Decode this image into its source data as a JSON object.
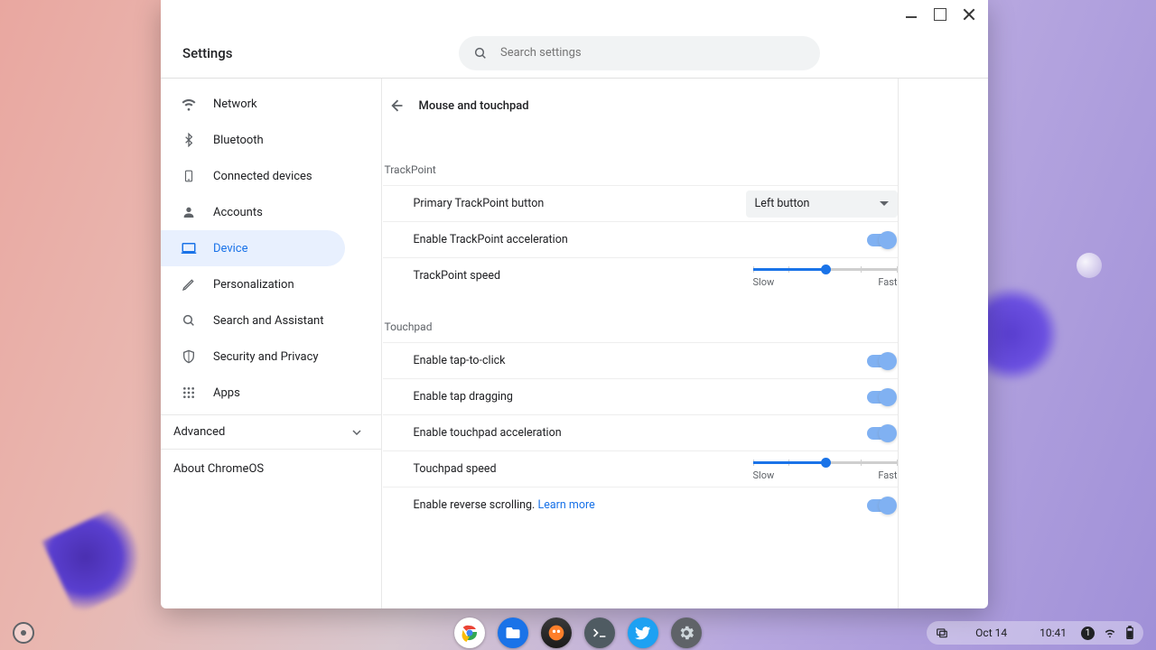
{
  "app": {
    "title": "Settings"
  },
  "search": {
    "placeholder": "Search settings"
  },
  "sidebar": {
    "items": [
      {
        "id": "network",
        "label": "Network"
      },
      {
        "id": "bluetooth",
        "label": "Bluetooth"
      },
      {
        "id": "connected",
        "label": "Connected devices"
      },
      {
        "id": "accounts",
        "label": "Accounts"
      },
      {
        "id": "device",
        "label": "Device"
      },
      {
        "id": "personalization",
        "label": "Personalization"
      },
      {
        "id": "search-assistant",
        "label": "Search and Assistant"
      },
      {
        "id": "security",
        "label": "Security and Privacy"
      },
      {
        "id": "apps",
        "label": "Apps"
      }
    ],
    "advanced": "Advanced",
    "about": "About ChromeOS"
  },
  "page": {
    "title": "Mouse and touchpad",
    "trackpoint": {
      "label": "TrackPoint",
      "primary_button_label": "Primary TrackPoint button",
      "primary_button_value": "Left button",
      "accel_label": "Enable TrackPoint acceleration",
      "speed_label": "TrackPoint speed",
      "speed_slow": "Slow",
      "speed_fast": "Fast",
      "speed_value_pct": 50
    },
    "touchpad": {
      "label": "Touchpad",
      "tap_click_label": "Enable tap-to-click",
      "tap_drag_label": "Enable tap dragging",
      "accel_label": "Enable touchpad acceleration",
      "speed_label": "Touchpad speed",
      "speed_slow": "Slow",
      "speed_fast": "Fast",
      "speed_value_pct": 50,
      "reverse_label": "Enable reverse scrolling.",
      "learn_more": "Learn more"
    }
  },
  "shelf": {
    "date": "Oct 14",
    "time": "10:41",
    "notif_count": "1"
  },
  "colors": {
    "accent": "#1a73e8"
  }
}
